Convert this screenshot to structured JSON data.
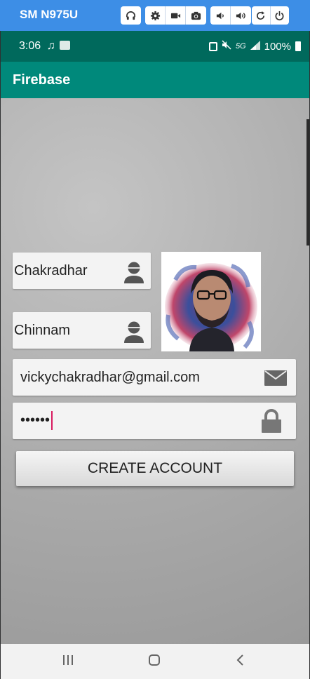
{
  "emulator": {
    "device_name": "SM N975U",
    "buttons": [
      "headphones-icon",
      "settings-icon",
      "video-icon",
      "camera-icon",
      "volume-down-icon",
      "volume-up-icon",
      "rotate-icon",
      "power-icon"
    ]
  },
  "status_bar": {
    "time": "3:06",
    "network": "5G",
    "battery": "100%"
  },
  "app_bar": {
    "title": "Firebase"
  },
  "form": {
    "first_name": {
      "value": "Chakradhar",
      "icon": "person-icon"
    },
    "last_name": {
      "value": "Chinnam",
      "icon": "person-icon"
    },
    "email": {
      "value": "vickychakradhar@gmail.com",
      "icon": "mail-icon"
    },
    "password": {
      "value": "••••••",
      "icon": "lock-icon"
    },
    "profile_photo": {
      "icon": "profile-photo"
    },
    "create_button": {
      "label": "CREATE ACCOUNT"
    }
  },
  "nav_bar": {
    "buttons": [
      "recents-icon",
      "home-icon",
      "back-icon"
    ]
  },
  "colors": {
    "status": "#00695c",
    "app_bar": "#00897b",
    "emulator": "#3d8ee6",
    "cursor": "#d81b60"
  }
}
